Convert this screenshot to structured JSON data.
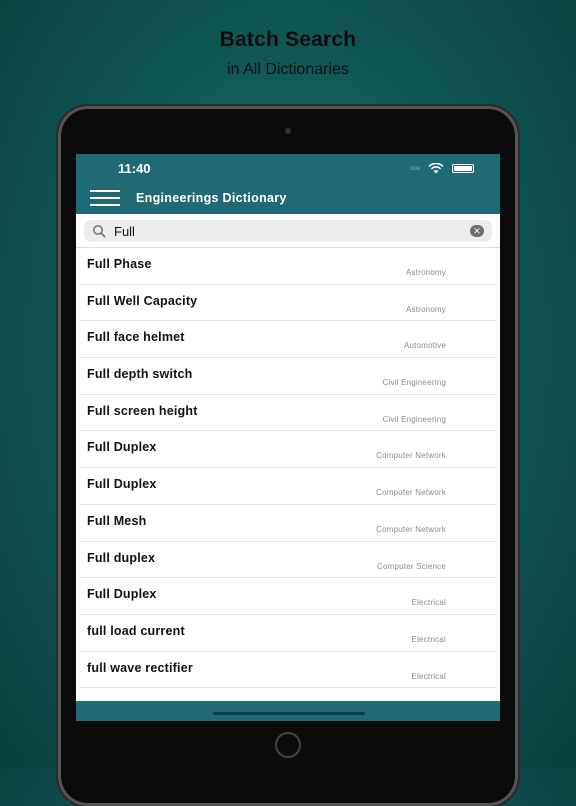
{
  "promo": {
    "title": "Batch Search",
    "subtitle": "in All Dictionaries"
  },
  "status_bar": {
    "time": "11:40",
    "signal_text": "ooo"
  },
  "header": {
    "title": "Engineerings Dictionary",
    "menu_icon": "hamburger-menu-icon"
  },
  "search": {
    "value": "Full",
    "icon": "search-icon",
    "clear_icon": "clear-icon"
  },
  "results": [
    {
      "term": "Full Phase",
      "category": "Astronomy"
    },
    {
      "term": "Full Well Capacity",
      "category": "Astronomy"
    },
    {
      "term": "Full face helmet",
      "category": "Automotive"
    },
    {
      "term": "Full depth switch",
      "category": "Civil Engineering"
    },
    {
      "term": "Full screen height",
      "category": "Civil Engineering"
    },
    {
      "term": "Full Duplex",
      "category": "Computer Network"
    },
    {
      "term": "Full Duplex",
      "category": "Computer Network"
    },
    {
      "term": "Full Mesh",
      "category": "Computer Network"
    },
    {
      "term": "Full duplex",
      "category": "Computer Science"
    },
    {
      "term": "Full Duplex",
      "category": "Electrical"
    },
    {
      "term": "full load current",
      "category": "Electrical"
    },
    {
      "term": "full wave rectifier",
      "category": "Electrical"
    }
  ],
  "colors": {
    "header": "#1f6a74",
    "background": "#115a57"
  }
}
